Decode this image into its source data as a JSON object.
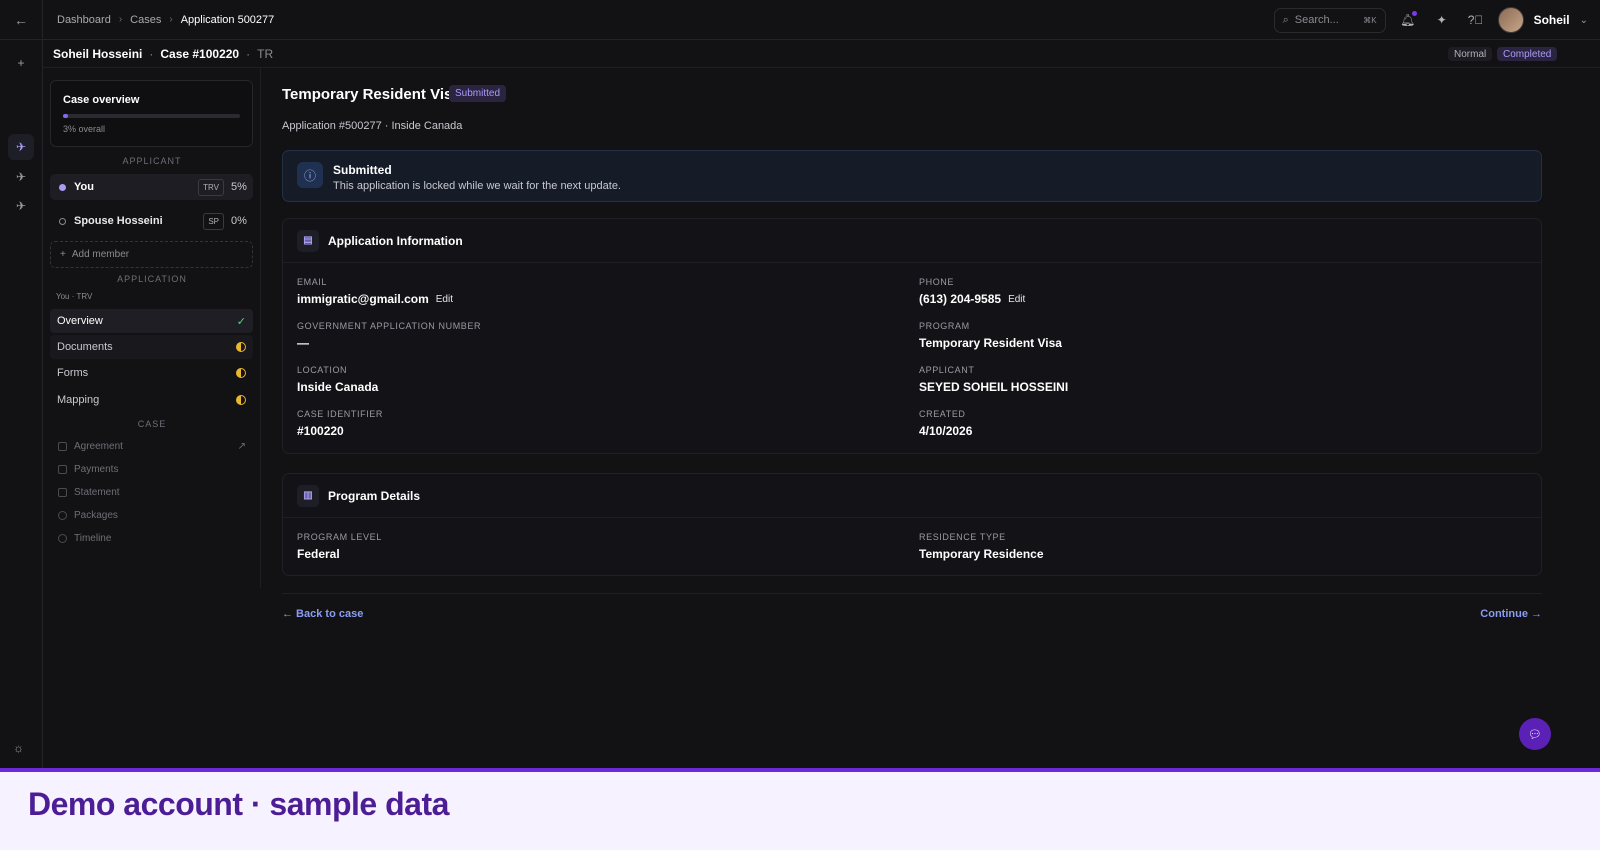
{
  "breadcrumbs": [
    "Dashboard",
    "Cases",
    "Application 500277"
  ],
  "search": {
    "placeholder": "Search...",
    "shortcut": "⌘K"
  },
  "user": {
    "name": "Soheil"
  },
  "case_header": {
    "client": "Soheil Hosseini",
    "case_no": "Case #100220",
    "code": "TR",
    "priority": "Normal",
    "status": "Completed"
  },
  "sidebar": {
    "overview_title": "Case overview",
    "overall_label": "3% overall",
    "overall_progress": 0.03,
    "applicant_heading": "APPLICANT",
    "members": [
      {
        "name": "You",
        "tag": "TRV",
        "pct": "5%"
      },
      {
        "name": "Spouse Hosseini",
        "tag": "SP",
        "pct": "0%"
      }
    ],
    "add_member": "Add member",
    "application_heading": "APPLICATION",
    "app_sub": "You · TRV",
    "nav": [
      "Overview",
      "Documents",
      "Forms",
      "Mapping"
    ],
    "case_heading": "CASE",
    "case_items": [
      "Agreement",
      "Payments",
      "Statement",
      "Packages",
      "Timeline"
    ]
  },
  "main": {
    "title": "Temporary Resident Visa",
    "status": "Submitted",
    "subline": "Application #500277 · Inside Canada",
    "banner": {
      "title": "Submitted",
      "desc": "This application is locked while we wait for the next update."
    },
    "info_title": "Application Information",
    "fields": {
      "email_label": "EMAIL",
      "email": "immigratic@gmail.com",
      "phone_label": "PHONE",
      "phone": "(613) 204-9585",
      "gov_label": "GOVERNMENT APPLICATION NUMBER",
      "gov": "—",
      "program_label": "PROGRAM",
      "program": "Temporary Resident Visa",
      "location_label": "LOCATION",
      "location": "Inside Canada",
      "applicant_label": "APPLICANT",
      "applicant": "SEYED SOHEIL HOSSEINI",
      "caseid_label": "CASE IDENTIFIER",
      "caseid": "#100220",
      "created_label": "CREATED",
      "created": "4/10/2026",
      "edit": "Edit"
    },
    "program_title": "Program Details",
    "program_fields": {
      "level_label": "PROGRAM LEVEL",
      "level": "Federal",
      "residence_label": "RESIDENCE TYPE",
      "residence": "Temporary Residence"
    },
    "back": "← Back to case",
    "continue": "Continue →"
  },
  "demo_banner": "Demo account · sample data",
  "colors": {
    "accent": "#7c6cf0",
    "link": "#8b9cf0",
    "warn": "#e8b930",
    "demo": "#4c1d95"
  }
}
